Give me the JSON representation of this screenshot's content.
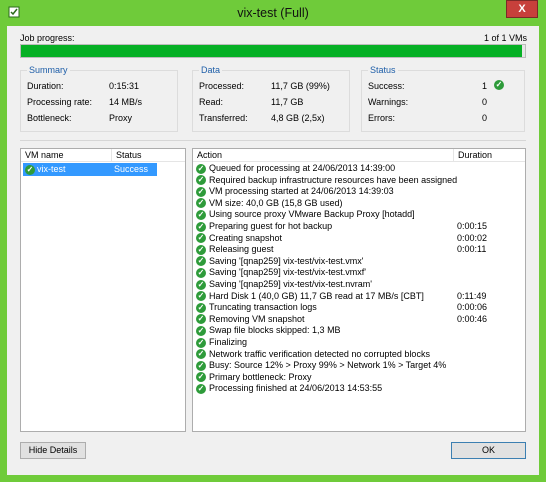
{
  "window": {
    "title": "vix-test (Full)",
    "close_label": "X"
  },
  "progress": {
    "label": "Job progress:",
    "value_text": "1 of 1 VMs",
    "fraction": 0.995
  },
  "summary": {
    "title": "Summary",
    "rows": [
      {
        "label": "Duration:",
        "value": "0:15:31"
      },
      {
        "label": "Processing rate:",
        "value": "14 MB/s"
      },
      {
        "label": "Bottleneck:",
        "value": "Proxy"
      }
    ]
  },
  "data_group": {
    "title": "Data",
    "rows": [
      {
        "label": "Processed:",
        "value": "11,7 GB (99%)"
      },
      {
        "label": "Read:",
        "value": "11,7 GB"
      },
      {
        "label": "Transferred:",
        "value": "4,8 GB (2,5x)"
      }
    ]
  },
  "status_group": {
    "title": "Status",
    "rows": [
      {
        "label": "Success:",
        "value": "1"
      },
      {
        "label": "Warnings:",
        "value": "0"
      },
      {
        "label": "Errors:",
        "value": "0"
      }
    ]
  },
  "vm_table": {
    "col_name": "VM name",
    "col_status": "Status",
    "rows": [
      {
        "name": "vix-test",
        "status": "Success"
      }
    ]
  },
  "action_table": {
    "col_action": "Action",
    "col_duration": "Duration",
    "rows": [
      {
        "action": "Queued for processing at 24/06/2013 14:39:00",
        "duration": ""
      },
      {
        "action": "Required backup infrastructure resources have been assigned",
        "duration": ""
      },
      {
        "action": "VM processing started at 24/06/2013 14:39:03",
        "duration": ""
      },
      {
        "action": "VM size: 40,0 GB (15,8 GB used)",
        "duration": ""
      },
      {
        "action": "Using source proxy VMware Backup Proxy [hotadd]",
        "duration": ""
      },
      {
        "action": "Preparing guest for hot backup",
        "duration": "0:00:15"
      },
      {
        "action": "Creating snapshot",
        "duration": "0:00:02"
      },
      {
        "action": "Releasing guest",
        "duration": "0:00:11"
      },
      {
        "action": "Saving '[qnap259] vix-test/vix-test.vmx'",
        "duration": ""
      },
      {
        "action": "Saving '[qnap259] vix-test/vix-test.vmxf'",
        "duration": ""
      },
      {
        "action": "Saving '[qnap259] vix-test/vix-test.nvram'",
        "duration": ""
      },
      {
        "action": "Hard Disk 1 (40,0 GB) 11,7 GB read at 17 MB/s [CBT]",
        "duration": "0:11:49"
      },
      {
        "action": "Truncating transaction logs",
        "duration": "0:00:06"
      },
      {
        "action": "Removing VM snapshot",
        "duration": "0:00:46"
      },
      {
        "action": "Swap file blocks skipped: 1,3 MB",
        "duration": ""
      },
      {
        "action": "Finalizing",
        "duration": ""
      },
      {
        "action": "Network traffic verification detected no corrupted blocks",
        "duration": ""
      },
      {
        "action": "Busy: Source 12% > Proxy 99% > Network 1% > Target 4%",
        "duration": ""
      },
      {
        "action": "Primary bottleneck: Proxy",
        "duration": ""
      },
      {
        "action": "Processing finished at 24/06/2013 14:53:55",
        "duration": ""
      }
    ]
  },
  "buttons": {
    "hide_details": "Hide Details",
    "ok": "OK"
  },
  "icons": {
    "app": "veeam-job-icon",
    "check": "success-check-icon"
  },
  "colors": {
    "chrome": "#6fcb3a",
    "progress": "#06b025",
    "group_title": "#1e5ea8",
    "selection": "#3399ff",
    "success": "#2e9b3a"
  }
}
